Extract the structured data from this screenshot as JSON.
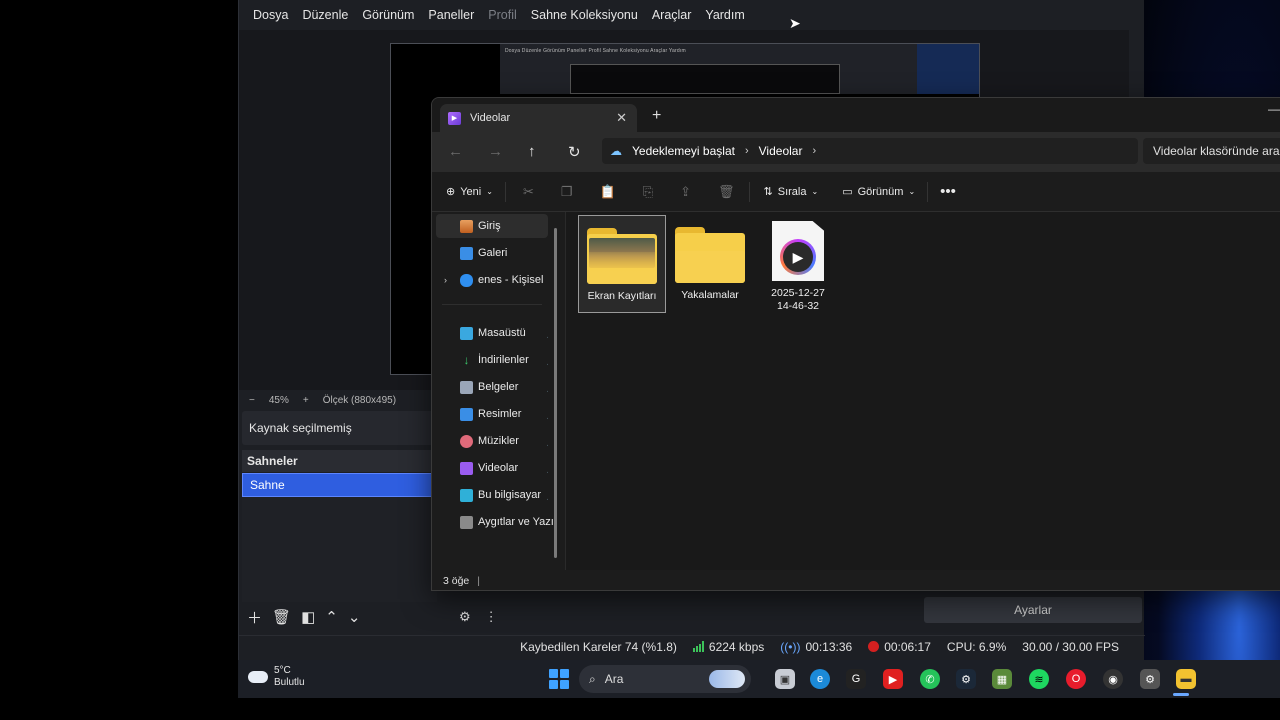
{
  "obs": {
    "menu": [
      "Dosya",
      "Düzenle",
      "Görünüm",
      "Paneller",
      "Profil",
      "Sahne Koleksiyonu",
      "Araçlar",
      "Yardım"
    ],
    "preview_menu_text": "Dosya  Düzenle  Görünüm  Paneller  Profil  Sahne Koleksiyonu  Araçlar  Yardım",
    "zoom": {
      "minus": "−",
      "value": "45%",
      "plus": "+",
      "scale": "Ölçek (880x495)"
    },
    "source_bar": "Kaynak seçilmemiş",
    "scenes": {
      "header": "Sahneler",
      "items": [
        "Sahne"
      ]
    },
    "settings_button": "Ayarlar",
    "status": {
      "dropped": "Kaybedilen Kareler 74 (%1.8)",
      "bitrate": "6224 kbps",
      "stream_time": "00:13:36",
      "rec_time": "00:06:17",
      "cpu": "CPU: 6.9%",
      "fps": "30.00 / 30.00 FPS"
    }
  },
  "explorer": {
    "tab_title": "Videolar",
    "breadcrumb": [
      "Yedeklemeyi başlat",
      "Videolar"
    ],
    "search_placeholder": "Videolar klasöründe ara",
    "commands": {
      "new": "Yeni",
      "sort": "Sırala",
      "view": "Görünüm"
    },
    "nav": {
      "top": [
        "Giriş",
        "Galeri",
        "enes - Kişisel"
      ],
      "pinned": [
        "Masaüstü",
        "İndirilenler",
        "Belgeler",
        "Resimler",
        "Müzikler",
        "Videolar",
        "Bu bilgisayar",
        "Aygıtlar ve Yazıcı"
      ]
    },
    "files": [
      {
        "name": "Ekran Kayıtları",
        "kind": "folder-with-thumbnail"
      },
      {
        "name": "Yakalamalar",
        "kind": "folder"
      },
      {
        "name_line1": "2025-12-27",
        "name_line2": "14-46-32",
        "kind": "video-file"
      }
    ],
    "status": "3 öğe"
  },
  "taskbar": {
    "weather_temp": "5°C",
    "weather_desc": "Bulutlu",
    "search_label": "Ara"
  },
  "colors": {
    "accent": "#2f5ee0",
    "folder": "#f6cf4a",
    "rec": "#d42020"
  }
}
